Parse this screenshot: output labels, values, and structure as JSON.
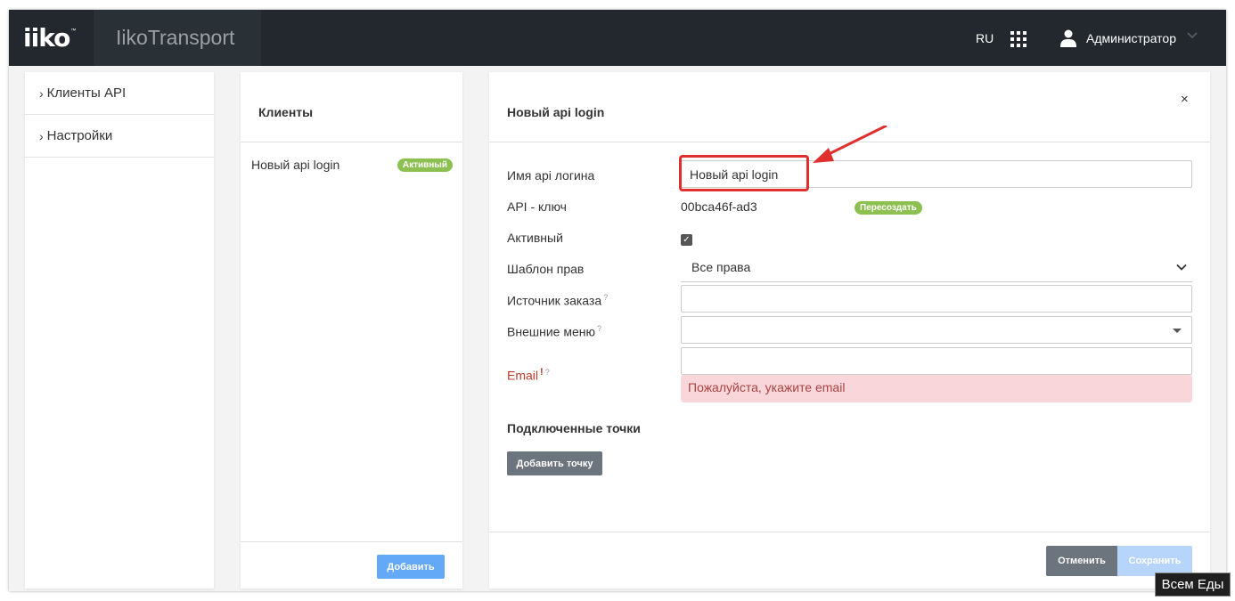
{
  "header": {
    "logo": "iiko",
    "logo_tm": "™",
    "app_title": "IikoTransport",
    "language": "RU",
    "user_name": "Администратор"
  },
  "sidebar": {
    "items": [
      {
        "label": "Клиенты API"
      },
      {
        "label": "Настройки"
      }
    ]
  },
  "clients": {
    "title": "Клиенты",
    "list": [
      {
        "name": "Новый api login",
        "status": "Активный"
      }
    ],
    "add_button": "Добавить"
  },
  "editor": {
    "title": "Новый api login",
    "close_symbol": "×",
    "fields": {
      "login_name_label": "Имя api логина",
      "login_name_value": "Новый api login",
      "api_key_label": "API - ключ",
      "api_key_value": "00bca46f-ad3",
      "regenerate_label": "Пересоздать",
      "active_label": "Активный",
      "active_checked": true,
      "rights_template_label": "Шаблон прав",
      "rights_template_value": "Все права",
      "order_source_label": "Источник заказа",
      "external_menu_label": "Внешние меню",
      "email_label": "Email",
      "email_error": "Пожалуйста, укажите email",
      "help_mark": "?",
      "required_mark": "!"
    },
    "connected_points_title": "Подключенные точки",
    "add_point_button": "Добавить точку",
    "cancel_button": "Отменить",
    "save_button": "Сохранить"
  },
  "colors": {
    "topbar": "#22282d",
    "active_badge": "#8cc152",
    "primary_button": "#64a8f8",
    "error_text": "#c0392b",
    "error_bg": "#f9d6da",
    "annotation_red": "#e02f2f"
  },
  "watermark": "Всем Еды"
}
